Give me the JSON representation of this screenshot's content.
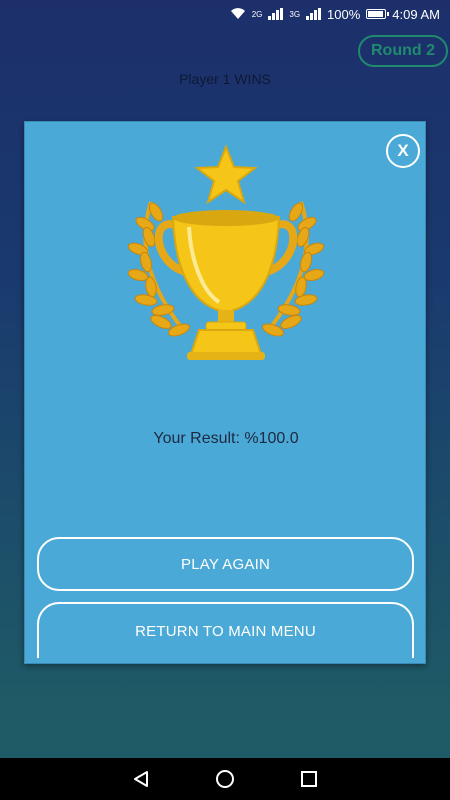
{
  "status_bar": {
    "network_left": "2G",
    "network_right": "3G",
    "battery": "100%",
    "time": "4:09 AM"
  },
  "header": {
    "round_label": "Round 2",
    "winner_text": "Player 1 WINS"
  },
  "dialog": {
    "close_label": "X",
    "result_text": "Your Result: %100.0",
    "play_again_label": "PLAY AGAIN",
    "return_menu_label": "RETURN TO MAIN MENU"
  },
  "icons": {
    "trophy": "trophy-icon",
    "back": "back-icon",
    "home": "home-icon",
    "recents": "recents-icon"
  },
  "colors": {
    "dialog_bg": "#4aa9d6",
    "accent_green": "#1f8a6e",
    "trophy_gold": "#f5c518"
  }
}
